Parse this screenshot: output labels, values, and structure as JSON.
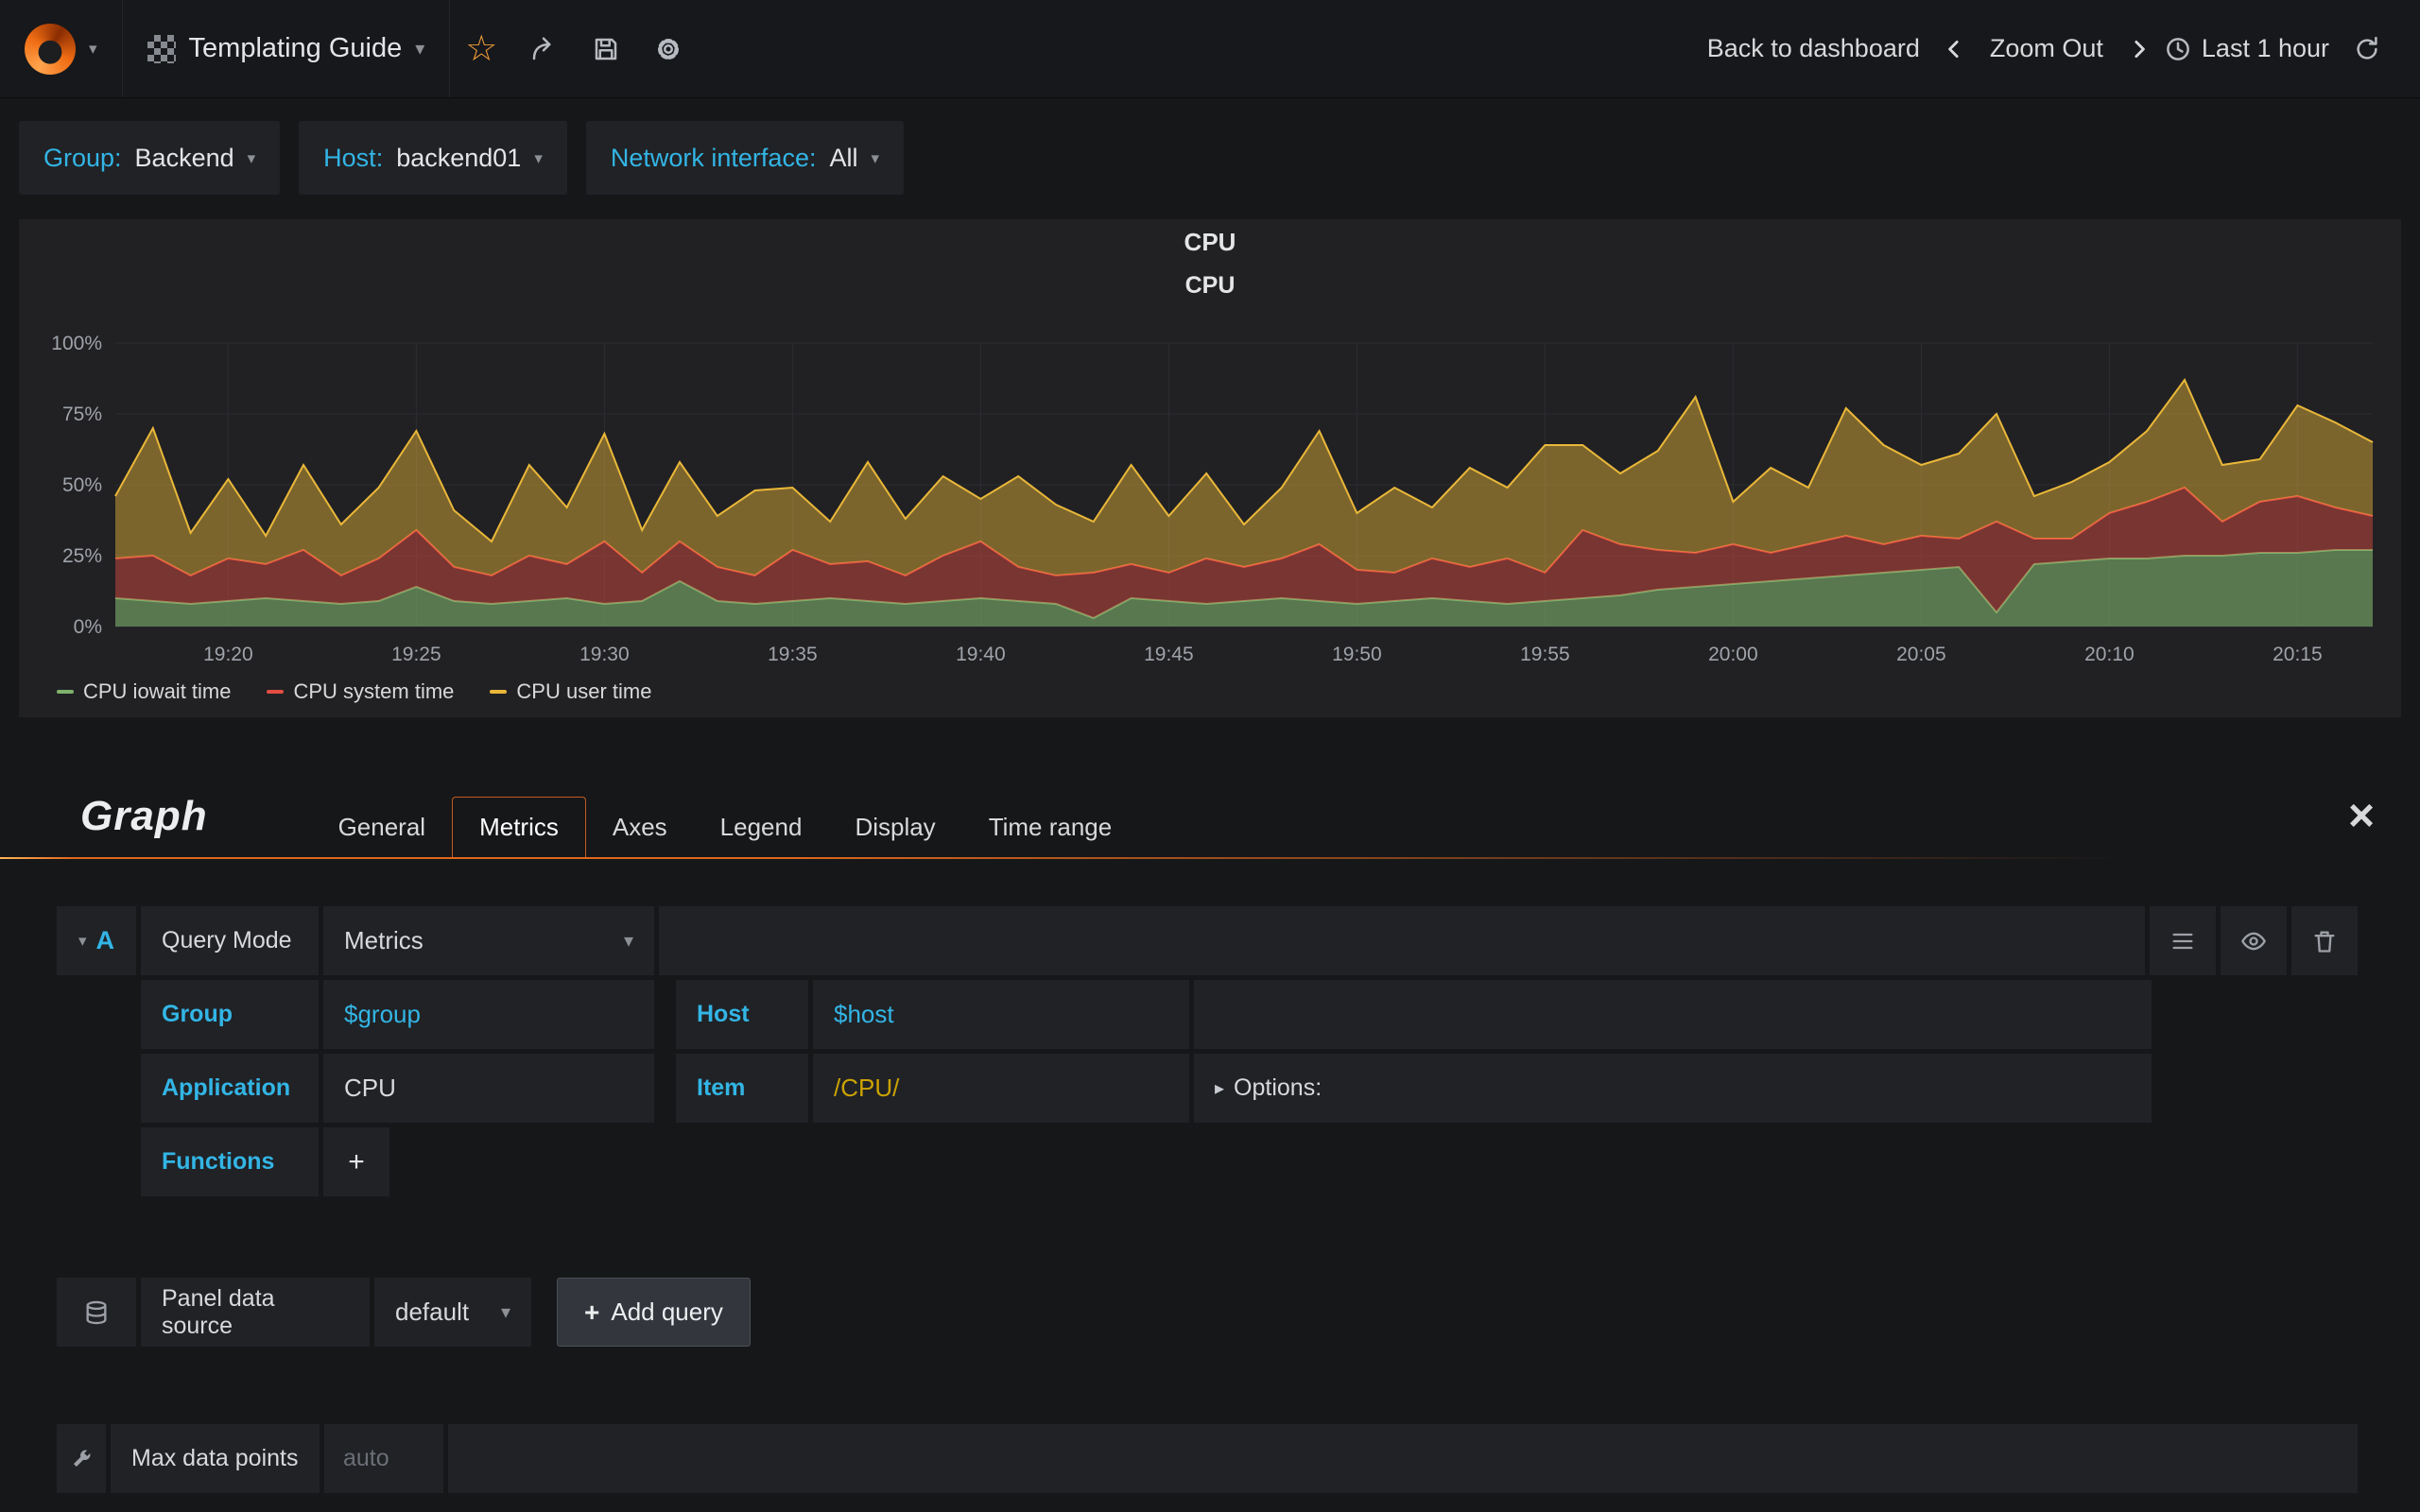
{
  "navbar": {
    "dashboard_title": "Templating Guide",
    "back_to_dashboard": "Back to dashboard",
    "zoom_out": "Zoom Out",
    "time_range": "Last 1 hour"
  },
  "variables": [
    {
      "label": "Group:",
      "value": "Backend"
    },
    {
      "label": "Host:",
      "value": "backend01"
    },
    {
      "label": "Network interface:",
      "value": "All"
    }
  ],
  "panel": {
    "title": "CPU"
  },
  "chart_data": {
    "type": "area",
    "stacked": true,
    "title": "CPU",
    "x_unit": "minutes from 19:17",
    "x": [
      0,
      1,
      2,
      3,
      4,
      5,
      6,
      7,
      8,
      9,
      10,
      11,
      12,
      13,
      14,
      15,
      16,
      17,
      18,
      19,
      20,
      21,
      22,
      23,
      24,
      25,
      26,
      27,
      28,
      29,
      30,
      31,
      32,
      33,
      34,
      35,
      36,
      37,
      38,
      39,
      40,
      41,
      42,
      43,
      44,
      45,
      46,
      47,
      48,
      49,
      50,
      51,
      52,
      53,
      54,
      55,
      56,
      57,
      58,
      59,
      60
    ],
    "series": [
      {
        "name": "CPU iowait time",
        "color": "#7eb26d",
        "values": [
          10,
          9,
          8,
          9,
          10,
          9,
          8,
          9,
          14,
          9,
          8,
          9,
          10,
          8,
          9,
          16,
          9,
          8,
          9,
          10,
          9,
          8,
          9,
          10,
          9,
          8,
          3,
          10,
          9,
          8,
          9,
          10,
          9,
          8,
          9,
          10,
          9,
          8,
          9,
          10,
          11,
          13,
          14,
          15,
          16,
          17,
          18,
          19,
          20,
          21,
          5,
          22,
          23,
          24,
          24,
          25,
          25,
          26,
          26,
          27,
          27
        ]
      },
      {
        "name": "CPU system time",
        "color": "#e24d42",
        "values": [
          14,
          16,
          10,
          15,
          12,
          18,
          10,
          15,
          20,
          12,
          10,
          16,
          12,
          22,
          10,
          14,
          12,
          10,
          18,
          12,
          14,
          10,
          16,
          20,
          12,
          10,
          16,
          12,
          10,
          16,
          12,
          14,
          20,
          12,
          10,
          14,
          12,
          16,
          10,
          24,
          18,
          14,
          12,
          14,
          10,
          12,
          14,
          10,
          12,
          10,
          32,
          9,
          8,
          16,
          20,
          24,
          12,
          18,
          20,
          15,
          12
        ]
      },
      {
        "name": "CPU user time",
        "color": "#eab839",
        "values": [
          22,
          45,
          15,
          28,
          10,
          30,
          18,
          25,
          35,
          20,
          12,
          32,
          20,
          38,
          15,
          28,
          18,
          30,
          22,
          15,
          35,
          20,
          28,
          15,
          32,
          25,
          18,
          35,
          20,
          30,
          15,
          25,
          40,
          20,
          30,
          18,
          35,
          25,
          45,
          30,
          25,
          35,
          55,
          15,
          30,
          20,
          45,
          35,
          25,
          30,
          38,
          15,
          20,
          18,
          25,
          38,
          20,
          15,
          32,
          30,
          26
        ]
      }
    ],
    "ylim": [
      0,
      100
    ],
    "yticks": [
      {
        "label": "0%",
        "v": 0
      },
      {
        "label": "25%",
        "v": 25
      },
      {
        "label": "50%",
        "v": 50
      },
      {
        "label": "75%",
        "v": 75
      },
      {
        "label": "100%",
        "v": 100
      }
    ],
    "xticks": [
      {
        "label": "19:20",
        "m": 3
      },
      {
        "label": "19:25",
        "m": 8
      },
      {
        "label": "19:30",
        "m": 13
      },
      {
        "label": "19:35",
        "m": 18
      },
      {
        "label": "19:40",
        "m": 23
      },
      {
        "label": "19:45",
        "m": 28
      },
      {
        "label": "19:50",
        "m": 33
      },
      {
        "label": "19:55",
        "m": 38
      },
      {
        "label": "20:00",
        "m": 43
      },
      {
        "label": "20:05",
        "m": 48
      },
      {
        "label": "20:10",
        "m": 53
      },
      {
        "label": "20:15",
        "m": 58
      }
    ],
    "grid": true,
    "legend_position": "bottom-left"
  },
  "editor": {
    "panel_type": "Graph",
    "tabs": [
      {
        "label": "General",
        "active": false
      },
      {
        "label": "Metrics",
        "active": true
      },
      {
        "label": "Axes",
        "active": false
      },
      {
        "label": "Legend",
        "active": false
      },
      {
        "label": "Display",
        "active": false
      },
      {
        "label": "Time range",
        "active": false
      }
    ],
    "query": {
      "letter": "A",
      "query_mode_label": "Query Mode",
      "query_mode_value": "Metrics",
      "group_label": "Group",
      "group_value": "$group",
      "host_label": "Host",
      "host_value": "$host",
      "application_label": "Application",
      "application_value": "CPU",
      "item_label": "Item",
      "item_value": "/CPU/",
      "options_label": "Options:",
      "functions_label": "Functions",
      "add_function_label": "+"
    },
    "datasource": {
      "label": "Panel data source",
      "value": "default",
      "add_query_label": "Add query"
    },
    "max_data_points": {
      "label": "Max data points",
      "placeholder": "auto"
    }
  },
  "colors": {
    "accent_cyan": "#33b5e5",
    "tab_accent_orange": "#e0681d",
    "item_value_yellow": "#cca300",
    "panel_background": "#212124",
    "page_background": "#161719"
  }
}
